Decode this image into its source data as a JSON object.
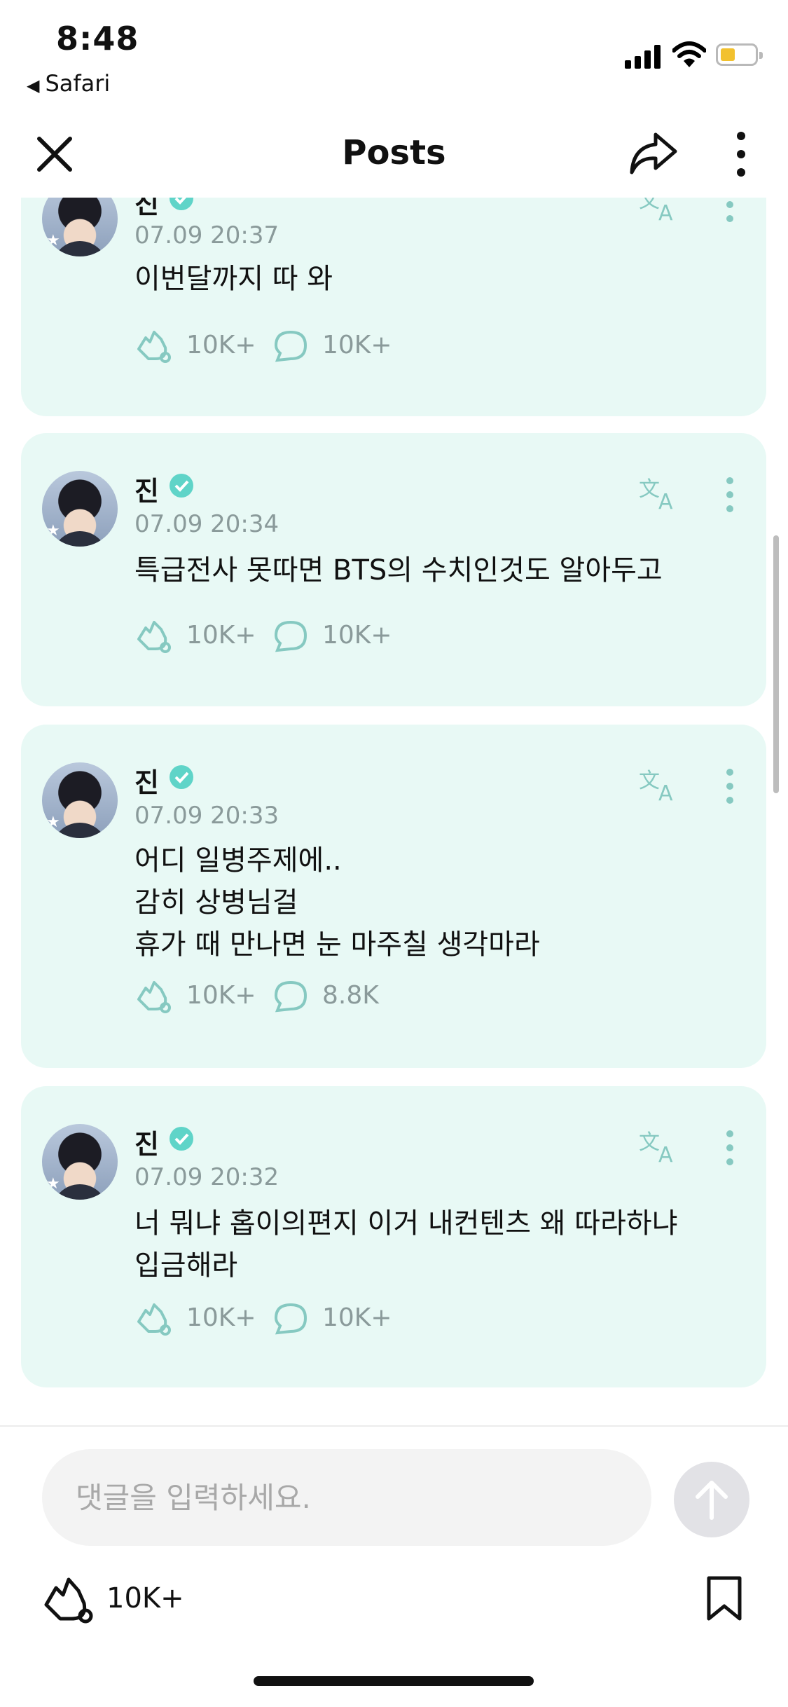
{
  "status_bar": {
    "time": "8:48",
    "back_app": "Safari"
  },
  "header": {
    "title": "Posts"
  },
  "posts": [
    {
      "name": "진",
      "date": "07.09 20:37",
      "text": "이번달까지 따 와",
      "likes": "10K+",
      "comments": "10K+"
    },
    {
      "name": "진",
      "date": "07.09 20:34",
      "text": "특급전사 못따면 BTS의 수치인것도 알아두고",
      "likes": "10K+",
      "comments": "10K+"
    },
    {
      "name": "진",
      "date": "07.09 20:33",
      "text": "어디 일병주제에..\n감히 상병님걸\n휴가 때 만나면 눈 마주칠 생각마라",
      "likes": "10K+",
      "comments": "8.8K"
    },
    {
      "name": "진",
      "date": "07.09 20:32",
      "text": "너 뭐냐 홉이의편지 이거 내컨텐츠 왜 따라하냐\n입금해라",
      "likes": "10K+",
      "comments": "10K+"
    }
  ],
  "comment_box": {
    "placeholder": "댓글을 입력하세요."
  },
  "footer": {
    "like_count": "10K+"
  },
  "colors": {
    "card_bg": "#e8f9f5",
    "accent": "#5fd4c8",
    "muted": "#8a9a9a"
  },
  "icons": [
    "close-icon",
    "share-icon",
    "more-icon",
    "verified-icon",
    "translate-icon",
    "kebab-icon",
    "like-icon",
    "comment-icon",
    "send-arrow-icon",
    "bookmark-icon"
  ]
}
